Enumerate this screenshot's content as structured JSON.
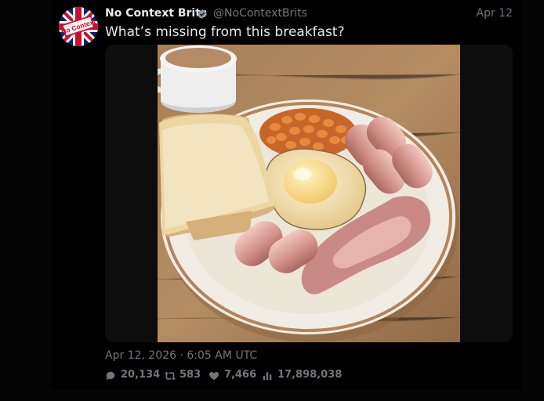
{
  "author": {
    "display_name": "No Context Brits",
    "handle": "@NoContextBrits",
    "avatar_text": "No Context",
    "verified_icon": "verified-badge-icon"
  },
  "tweet": {
    "date_short": "Apr 12",
    "text": "What’s missing from this breakfast?",
    "timestamp": "Apr 12, 2026 · 6:05 AM UTC",
    "media_subject": "full-english-breakfast-photo"
  },
  "stats": {
    "replies": "20,134",
    "retweets": "583",
    "likes": "7,466",
    "views": "17,898,038"
  },
  "colors": {
    "background": "#000000",
    "primary_text": "#e7e9ea",
    "secondary_text": "#71767b",
    "verified": "#8b98a5"
  }
}
